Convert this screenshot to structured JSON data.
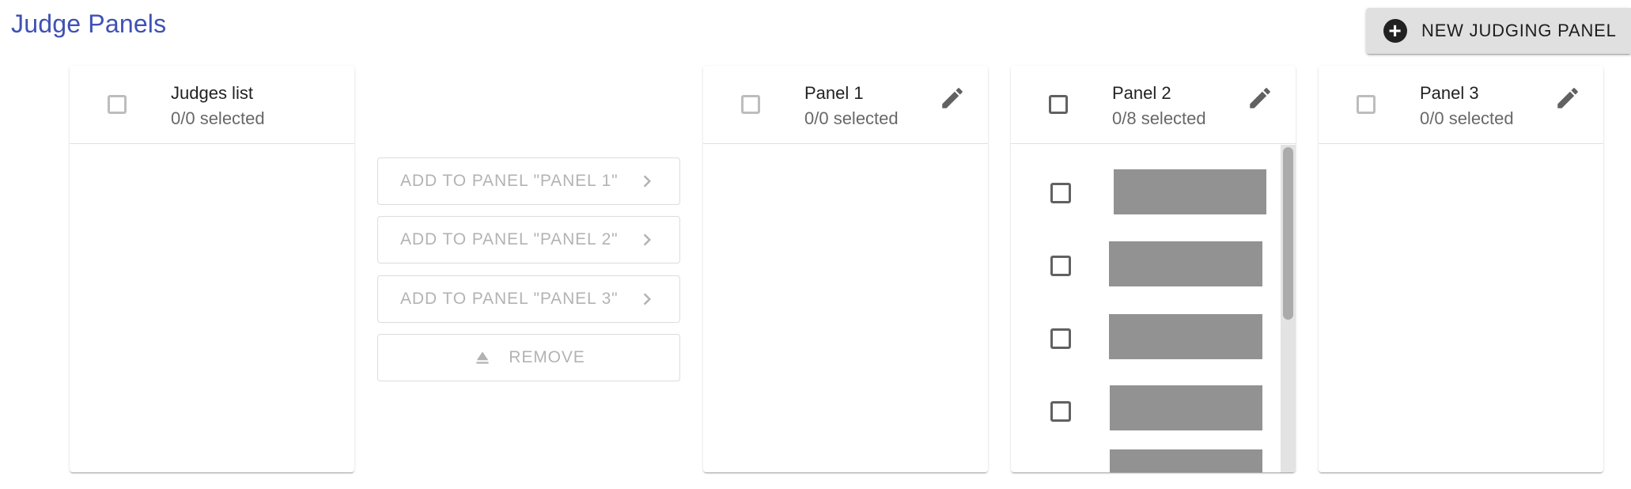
{
  "page": {
    "title": "Judge Panels"
  },
  "new_panel_button": {
    "label": "NEW JUDGING PANEL",
    "icon": "plus-circle-icon"
  },
  "judges_list": {
    "title": "Judges list",
    "selected": "0/0 selected"
  },
  "actions": {
    "add_panel_1": "ADD TO PANEL \"PANEL 1\"",
    "add_panel_2": "ADD TO PANEL \"PANEL 2\"",
    "add_panel_3": "ADD TO PANEL \"PANEL 3\"",
    "remove": "REMOVE"
  },
  "panels": [
    {
      "title": "Panel 1",
      "selected": "0/0 selected",
      "items": 0
    },
    {
      "title": "Panel 2",
      "selected": "0/8 selected",
      "items": 8
    },
    {
      "title": "Panel 3",
      "selected": "0/0 selected",
      "items": 0
    }
  ],
  "colors": {
    "title_accent": "#3f51b5",
    "disabled_text": "rgba(0,0,0,0.3)",
    "redaction": "#929292",
    "button_bg": "#e0e0e0"
  }
}
